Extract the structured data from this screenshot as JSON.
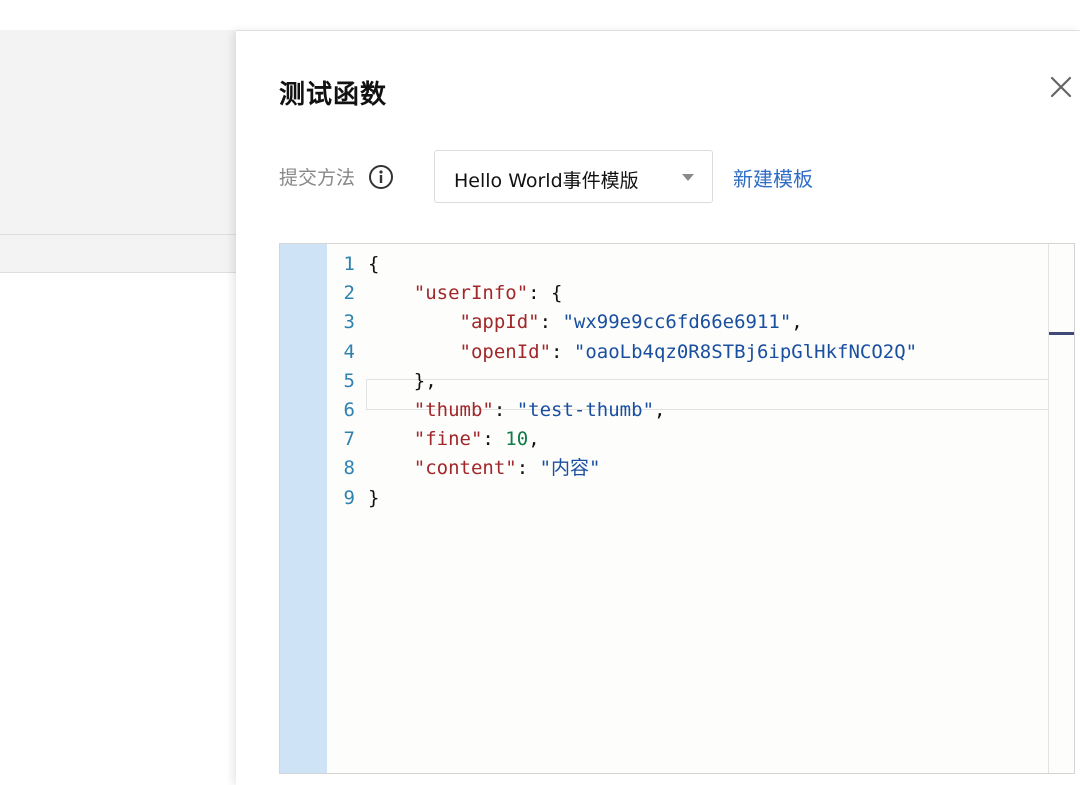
{
  "drawer": {
    "title": "测试函数",
    "close_icon": "close-icon"
  },
  "form": {
    "method_label": "提交方法",
    "info_icon": "info-icon",
    "template_select": {
      "value": "Hello World事件模版",
      "icon": "caret-down-icon"
    },
    "new_template_link": "新建模板"
  },
  "editor": {
    "line_numbers": [
      "1",
      "2",
      "3",
      "4",
      "5",
      "6",
      "7",
      "8",
      "9"
    ],
    "active_line": 5,
    "lines": [
      [
        {
          "t": "p",
          "v": "{"
        }
      ],
      [
        {
          "t": "p",
          "v": "    "
        },
        {
          "t": "k",
          "v": "\"userInfo\""
        },
        {
          "t": "p",
          "v": ": {"
        }
      ],
      [
        {
          "t": "p",
          "v": "        "
        },
        {
          "t": "k",
          "v": "\"appId\""
        },
        {
          "t": "p",
          "v": ": "
        },
        {
          "t": "s",
          "v": "\"wx99e9cc6fd66e6911\""
        },
        {
          "t": "p",
          "v": ","
        }
      ],
      [
        {
          "t": "p",
          "v": "        "
        },
        {
          "t": "k",
          "v": "\"openId\""
        },
        {
          "t": "p",
          "v": ": "
        },
        {
          "t": "s",
          "v": "\"oaoLb4qz0R8STBj6ipGlHkfNCO2Q\""
        }
      ],
      [
        {
          "t": "p",
          "v": "    },"
        }
      ],
      [
        {
          "t": "p",
          "v": "    "
        },
        {
          "t": "k",
          "v": "\"thumb\""
        },
        {
          "t": "p",
          "v": ": "
        },
        {
          "t": "s",
          "v": "\"test-thumb\""
        },
        {
          "t": "p",
          "v": ","
        }
      ],
      [
        {
          "t": "p",
          "v": "    "
        },
        {
          "t": "k",
          "v": "\"fine\""
        },
        {
          "t": "p",
          "v": ": "
        },
        {
          "t": "n",
          "v": "10"
        },
        {
          "t": "p",
          "v": ","
        }
      ],
      [
        {
          "t": "p",
          "v": "    "
        },
        {
          "t": "k",
          "v": "\"content\""
        },
        {
          "t": "p",
          "v": ": "
        },
        {
          "t": "s",
          "v": "\"内容\""
        }
      ],
      [
        {
          "t": "p",
          "v": "}"
        }
      ]
    ]
  },
  "colors": {
    "link": "#2f6dc6",
    "json_key": "#a1272b",
    "json_string": "#1a4fa0",
    "json_number": "#117a4a",
    "line_number": "#2e82b1",
    "gutter": "#cfe3f6"
  }
}
